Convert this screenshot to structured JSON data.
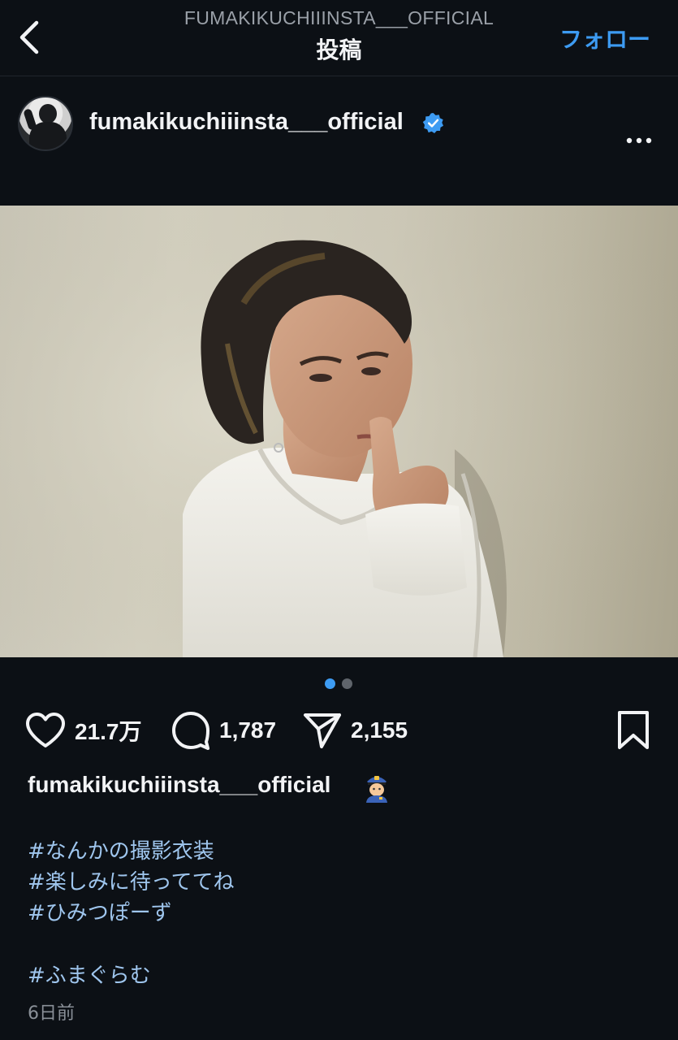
{
  "header": {
    "account_handle": "FUMAKIKUCHIIINSTA___OFFICIAL",
    "title": "投稿",
    "follow_label": "フォロー"
  },
  "post": {
    "username": "fumakikuchiiinsta___official",
    "verified": true,
    "carousel": {
      "total": 2,
      "current": 1
    },
    "likes": "21.7万",
    "comments": "1,787",
    "shares": "2,155",
    "caption": {
      "username": "fumakikuchiiinsta___official",
      "emoji": "police-officer-emoji",
      "hashtags": [
        "#なんかの撮影衣装",
        "#楽しみに待っててね",
        "#ひみつぽーず",
        "#ふまぐらむ"
      ]
    },
    "timestamp": "6日前"
  },
  "colors": {
    "background": "#0c1015",
    "accent": "#3d9bf2",
    "hashtag": "#9fc6ee"
  }
}
